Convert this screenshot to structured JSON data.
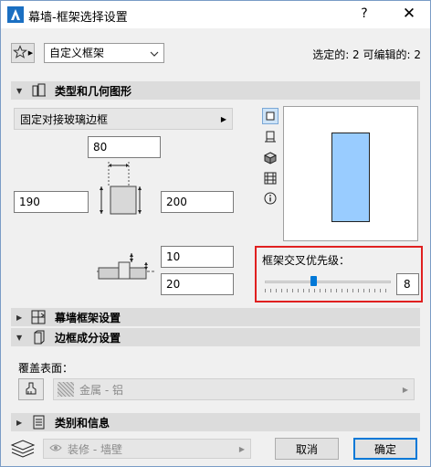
{
  "window": {
    "title": "幕墙-框架选择设置",
    "help": "?",
    "close": "✕"
  },
  "favorites": {
    "selected": "自定义框架"
  },
  "selection_info": "选定的: 2 可编辑的: 2",
  "sections": {
    "type_geometry": "类型和几何图形",
    "curtainwall_frame": "幕墙框架设置",
    "frame_components": "边框成分设置",
    "category": "类别和信息"
  },
  "frame_type": "固定对接玻璃边框",
  "dimensions": {
    "top": "80",
    "left": "190",
    "right": "200",
    "offset1": "10",
    "offset2": "20"
  },
  "priority": {
    "label": "框架交叉优先级：",
    "value": "8",
    "slider_fraction": 0.38
  },
  "cover_surface": {
    "label": "覆盖表面：",
    "material": "金属 - 铝"
  },
  "layer": {
    "name": "装修 - 墙壁"
  },
  "buttons": {
    "cancel": "取消",
    "ok": "确定"
  },
  "colors": {
    "preview_fill": "#99ccff",
    "highlight": "#e02020",
    "accent": "#0078d7"
  }
}
